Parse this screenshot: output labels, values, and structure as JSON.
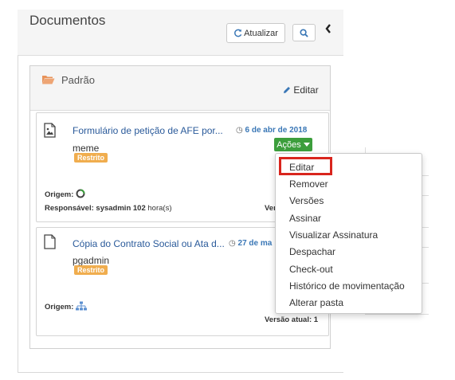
{
  "header": {
    "title": "Documentos",
    "refresh_label": "Atualizar",
    "search_icon": "search-icon",
    "collapse_icon": "chevron-left-icon"
  },
  "folder": {
    "name": "Padrão",
    "edit_label": "Editar",
    "folder_icon": "folder-open-icon",
    "folder_color": "#e8935a"
  },
  "documents": [
    {
      "title": "Formulário de petição de AFE por...",
      "date": "6 de abr de 2018",
      "owner": "meme",
      "badge": "Restrito",
      "origin_label": "Origem:",
      "responsible_label": "Responsável:",
      "responsible_value": "sysadmin 102",
      "responsible_suffix": "hora(s)",
      "version_label": "Ver",
      "actions_label": "Ações"
    },
    {
      "title": "Cópia do Contrato Social ou Ata d...",
      "date": "27 de ma",
      "owner": "pgadmin",
      "badge": "Restrito",
      "origin_label": "Origem:",
      "version_label": "Versão atual: 1"
    }
  ],
  "actions_menu": [
    "Editar",
    "Remover",
    "Versões",
    "Assinar",
    "Visualizar Assinatura",
    "Despachar",
    "Check-out",
    "Histórico de movimentação",
    "Alterar pasta"
  ],
  "colors": {
    "accent_green": "#3c9e3c",
    "link_blue": "#2a5a9a",
    "badge_orange": "#f0ad4e",
    "highlight_red": "#d9251d"
  }
}
